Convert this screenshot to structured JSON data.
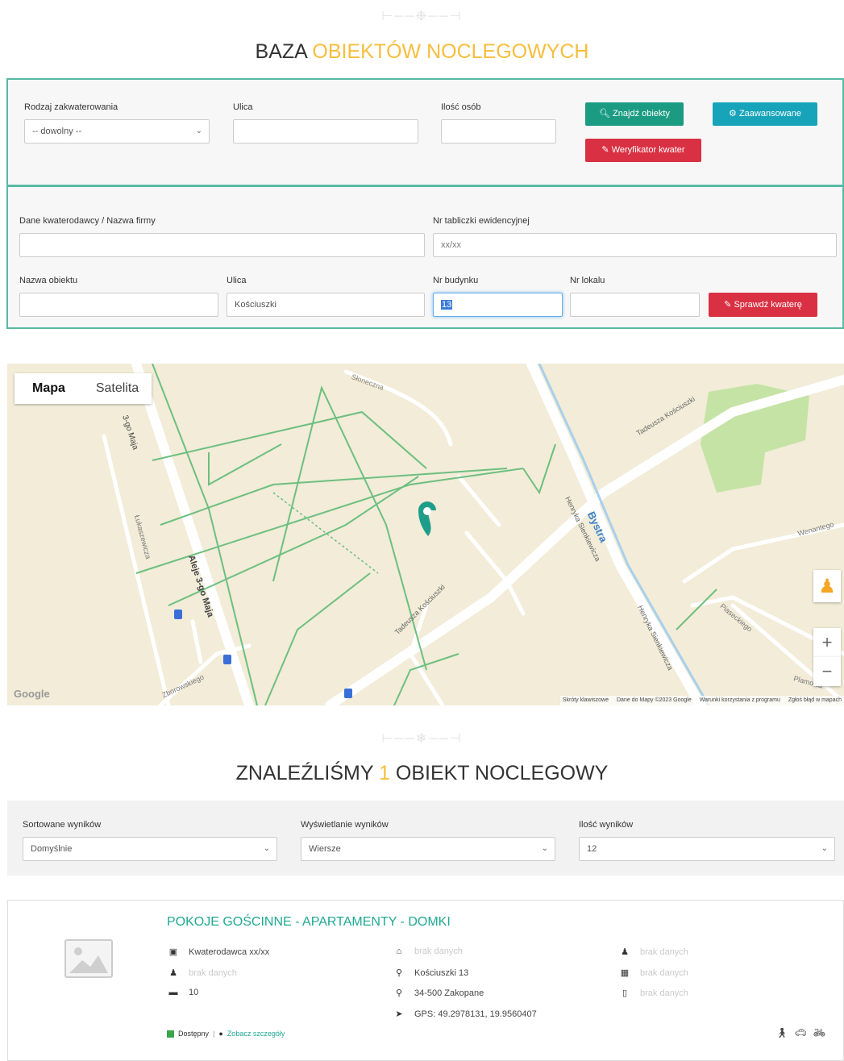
{
  "header": {
    "title_part1": "BAZA",
    "title_part2": "OBIEKTÓW NOCLEGOWYCH"
  },
  "search": {
    "type_label": "Rodzaj zakwaterowania",
    "type_value": "-- dowolny --",
    "street_label": "Ulica",
    "street_value": "",
    "persons_label": "Ilość osób",
    "persons_value": "",
    "find_button": "Znajdź obiekty",
    "advanced_button": "Zaawansowane",
    "verifier_button": "Weryfikator kwater"
  },
  "verifier": {
    "landlord_label": "Dane kwaterodawcy / Nazwa firmy",
    "landlord_value": "",
    "plate_label": "Nr tabliczki ewidencyjnej",
    "plate_placeholder": "xx/xx",
    "object_label": "Nazwa obiektu",
    "object_value": "",
    "street_label": "Ulica",
    "street_value": "Kościuszki",
    "building_label": "Nr budynku",
    "building_value": "13",
    "apartment_label": "Nr lokalu",
    "apartment_value": "",
    "check_button": "Sprawdź kwaterę"
  },
  "map": {
    "tab_map": "Mapa",
    "tab_satellite": "Satelita",
    "google": "Google",
    "footer_shortcuts": "Skróty klawiszowe",
    "footer_data": "Dane do Mapy ©2023 Google",
    "footer_terms": "Warunki korzystania z programu",
    "footer_report": "Zgłoś błąd w mapach",
    "street_names": {
      "sloneczna": "Słoneczna",
      "tadeusza_top": "Tadeusza Kościuszki",
      "tadeusza_bottom": "Tadeusza Kościuszki",
      "maja_top": "3-go Maja",
      "aleje": "Aleje 3-go Maja",
      "lukaszewicza": "Łukaszewicza",
      "zborowskiego": "Zborowskiego",
      "bystra": "Bystra",
      "henryka1": "Henryka Sienkiewicza",
      "henryka2": "Henryka Sienkiewicza",
      "wenantego": "Wenantego",
      "piaseckiego": "Piaseckiego",
      "plamowa": "Plamowa"
    }
  },
  "results": {
    "heading_part1": "ZNALEŹLIŚMY",
    "count": "1",
    "heading_part2": "OBIEKT NOCLEGOWY",
    "sort_label": "Sortowane wyników",
    "sort_value": "Domyślnie",
    "display_label": "Wyświetlanie wyników",
    "display_value": "Wiersze",
    "perpage_label": "Ilość wyników",
    "perpage_value": "12"
  },
  "listing": {
    "title": "POKOJE GOŚCINNE - APARTAMENTY - DOMKI",
    "col1": [
      "Kwaterodawca xx/xx",
      "brak danych",
      "10"
    ],
    "col2": [
      "brak danych",
      "Kościuszki 13",
      "34-500 Zakopane",
      "GPS: 49.2978131, 19.9560407"
    ],
    "col3": [
      "brak danych",
      "brak danych",
      "brak danych"
    ],
    "available": "Dostępny",
    "separator": "|",
    "details_link": "Zobacz szczegóły"
  },
  "colors": {
    "accent": "#f6be3c",
    "teal": "#1c9b83",
    "cyan": "#17a4ba",
    "red": "#d93143",
    "border": "#59b9a4"
  }
}
